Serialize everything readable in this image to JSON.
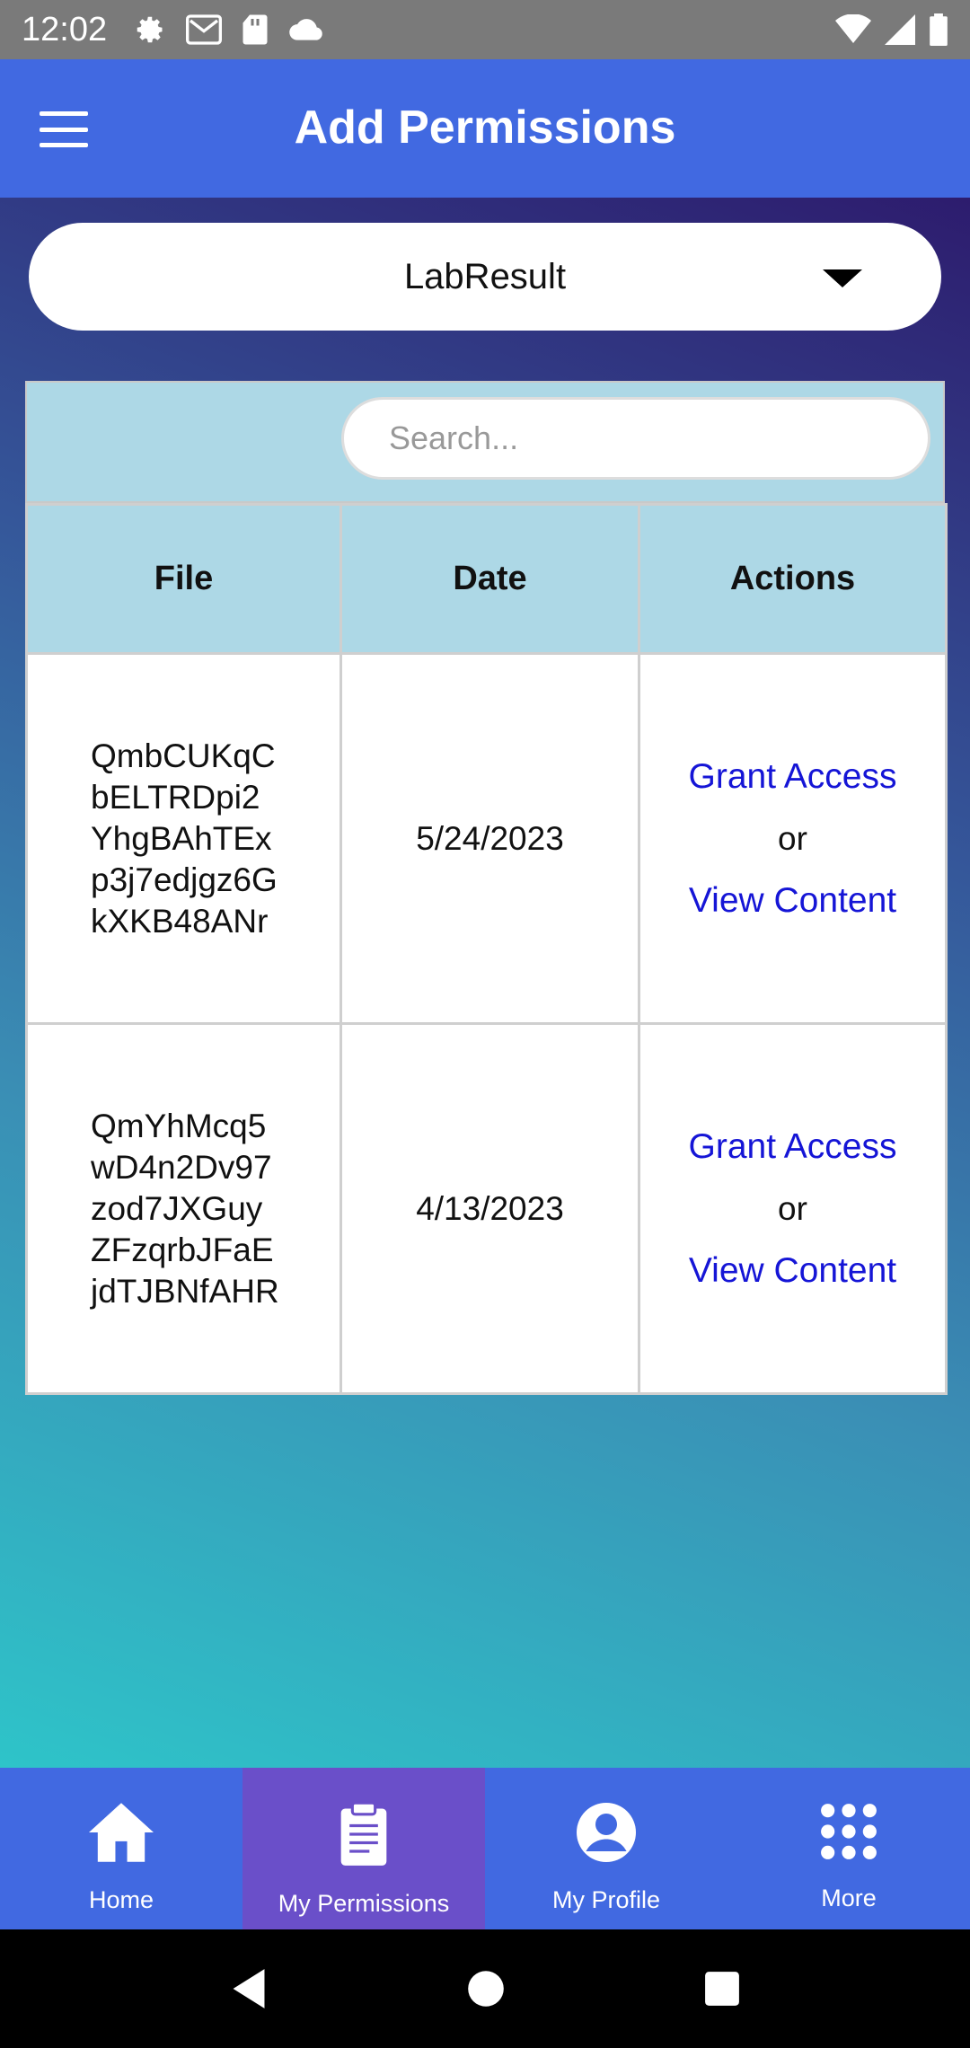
{
  "status_bar": {
    "time": "12:02"
  },
  "app_bar": {
    "title": "Add Permissions"
  },
  "dropdown": {
    "selected": "LabResult"
  },
  "search": {
    "placeholder": "Search..."
  },
  "table": {
    "headers": [
      "File",
      "Date",
      "Actions"
    ],
    "rows": [
      {
        "file": "QmbCUKqCbELTRDpi2YhgBAhTExp3j7edjgz6GkXKB48ANr",
        "date": "5/24/2023",
        "grant": "Grant Access",
        "or": "or",
        "view": "View Content"
      },
      {
        "file": "QmYhMcq5wD4n2Dv97zod7JXGuyZFzqrbJFaEjdTJBNfAHR",
        "date": "4/13/2023",
        "grant": "Grant Access",
        "or": "or",
        "view": "View Content"
      }
    ]
  },
  "bottom_nav": {
    "items": [
      {
        "label": "Home",
        "icon": "home-icon"
      },
      {
        "label": "My Permissions",
        "icon": "clipboard-icon"
      },
      {
        "label": "My Profile",
        "icon": "account-circle-icon"
      },
      {
        "label": "More",
        "icon": "grid-icon"
      }
    ],
    "active_index": 1
  },
  "colors": {
    "app_bar": "#4169e1",
    "active_tab": "#6a4fc9",
    "table_header": "#add8e6",
    "link": "#1515d6"
  }
}
